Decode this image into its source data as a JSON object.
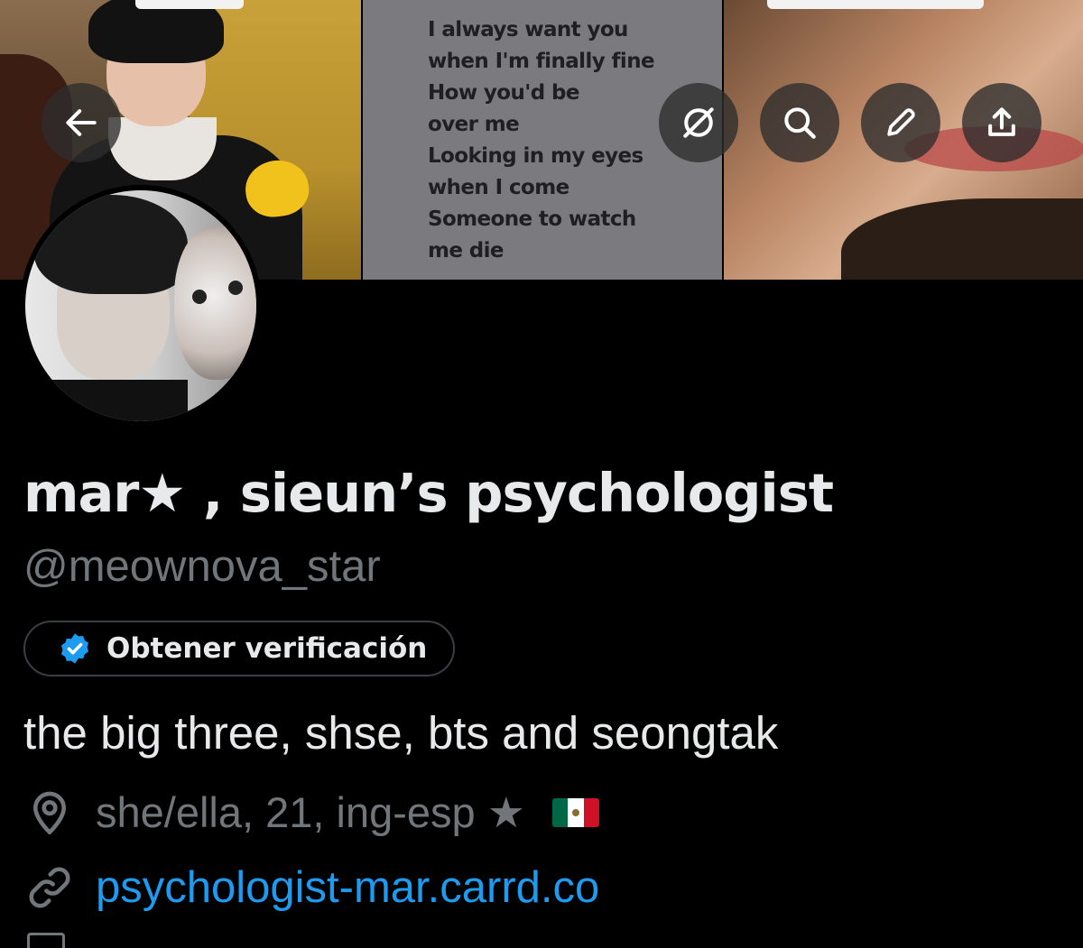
{
  "header": {
    "back_icon": "arrow-left-icon",
    "actions": [
      {
        "name": "grok-button",
        "icon": "slashed-circle-icon"
      },
      {
        "name": "search-button",
        "icon": "search-icon"
      },
      {
        "name": "edit-button",
        "icon": "pencil-icon"
      },
      {
        "name": "share-button",
        "icon": "share-icon"
      }
    ]
  },
  "banner": {
    "lyrics": [
      "I always want you",
      "when I'm finally fine",
      "How you'd be",
      "over me",
      "Looking in my eyes",
      "when I come",
      "Someone to watch",
      "me die"
    ]
  },
  "profile": {
    "display_name": "mar★ , sieun’s psychologist",
    "handle": "@meownova_star",
    "verify_label": "Obtener verificación",
    "bio": "the big three, shse, bts and seongtak",
    "location": "she/ella, 21, ing-esp ★",
    "location_flag": "mexico-flag-icon",
    "website": "psychologist-mar.carrd.co"
  },
  "colors": {
    "background": "#000000",
    "primary_text": "#e7e9ea",
    "secondary_text": "#71767b",
    "link": "#1d9bf0",
    "verified_badge": "#1d9bf0"
  }
}
